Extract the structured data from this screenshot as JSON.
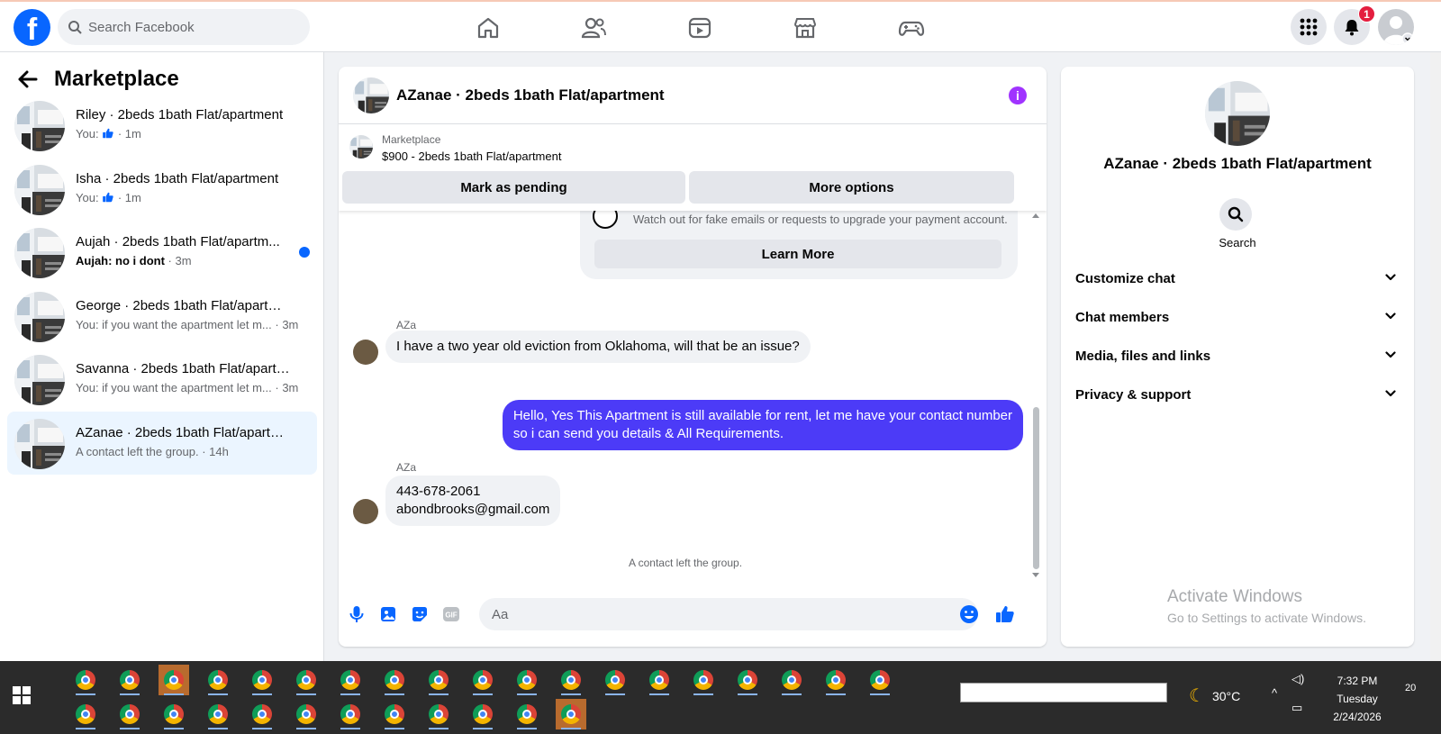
{
  "topbar": {
    "search_placeholder": "Search Facebook",
    "notification_count": "1",
    "icons": [
      "facebook-logo",
      "home-icon",
      "friends-icon",
      "video-icon",
      "marketplace-icon",
      "gaming-icon",
      "menu-grid-icon",
      "bell-icon",
      "profile-avatar"
    ]
  },
  "sidebar": {
    "title": "Marketplace",
    "conversations": [
      {
        "name": "Riley · 2beds 1bath Flat/apartment",
        "preview": "You:",
        "time": "· 1m",
        "has_like": true
      },
      {
        "name": "Isha · 2beds 1bath Flat/apartment",
        "preview": "You:",
        "time": "· 1m",
        "has_like": true
      },
      {
        "name": "Aujah · 2beds 1bath Flat/apartm...",
        "preview": "Aujah: no i dont",
        "time": "· 3m",
        "unread": true
      },
      {
        "name": "George · 2beds 1bath Flat/apartme...",
        "preview": "You: if you want the apartment let m...",
        "time": "· 3m"
      },
      {
        "name": "Savanna · 2beds 1bath Flat/apartm...",
        "preview": "You: if you want the apartment let m...",
        "time": "· 3m"
      },
      {
        "name": "AZanae · 2beds 1bath Flat/apartm...",
        "preview": "A contact left the group.",
        "time": "· 14h",
        "active": true
      }
    ]
  },
  "chat": {
    "title": "AZanae · 2beds 1bath Flat/apartment",
    "listing": {
      "label": "Marketplace",
      "price_title": "$900 - 2beds 1bath Flat/apartment",
      "mark_pending": "Mark as pending",
      "more_options": "More options"
    },
    "warning": {
      "text": "Watch out for fake emails or requests to upgrade your payment account.",
      "learn_more": "Learn More"
    },
    "messages": [
      {
        "sender": "AZa",
        "direction": "in",
        "text": "I have a two year old eviction from Oklahoma, will that be an issue?"
      },
      {
        "direction": "out",
        "line1": "Hello, Yes This Apartment is still available for rent, let me have your contact number",
        "line2": "so i can send you details & All Requirements."
      },
      {
        "sender": "AZa",
        "direction": "in",
        "line1": "443-678-2061",
        "line2": "abondbrooks@gmail.com"
      }
    ],
    "system_note": "A contact left the group.",
    "composer_placeholder": "Aa"
  },
  "details": {
    "title": "AZanae · 2beds 1bath Flat/apartment",
    "search_label": "Search",
    "sections": [
      "Customize chat",
      "Chat members",
      "Media, files and links",
      "Privacy & support"
    ]
  },
  "watermark": {
    "line1": "Activate Windows",
    "line2": "Go to Settings to activate Windows."
  },
  "taskbar": {
    "temperature": "30°C",
    "time": "7:32 PM",
    "day": "Tuesday",
    "date": "2/24/2026",
    "notifications": "20"
  },
  "colors": {
    "facebook_blue": "#0866ff",
    "outgoing_bubble": "#4c3bf7",
    "info_purple": "#a033ff",
    "active_conv": "#ebf5ff"
  }
}
